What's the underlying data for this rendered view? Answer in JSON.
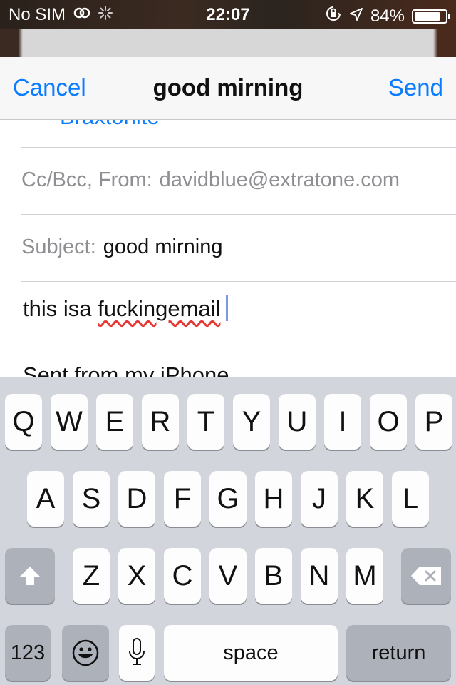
{
  "status_bar": {
    "carrier": "No SIM",
    "time": "22:07",
    "battery_percent": "84%",
    "battery_level": 0.84,
    "icons": [
      "wifi-sync-icon",
      "activity-spinner-icon",
      "orientation-lock-icon",
      "location-arrow-icon",
      "battery-icon"
    ]
  },
  "nav": {
    "cancel_label": "Cancel",
    "title": "good mirning",
    "send_label": "Send"
  },
  "compose": {
    "to_partial": "Braxtonite",
    "cc_label": "Cc/Bcc, From:",
    "from_value": "davidblue@extratone.com",
    "subject_label": "Subject:",
    "subject_value": "good mirning",
    "body_prefix": "this isa ",
    "body_misspelled": "fuckingemail",
    "signature": "Sent from my iPhone"
  },
  "keyboard": {
    "row1": [
      "Q",
      "W",
      "E",
      "R",
      "T",
      "Y",
      "U",
      "I",
      "O",
      "P"
    ],
    "row2": [
      "A",
      "S",
      "D",
      "F",
      "G",
      "H",
      "J",
      "K",
      "L"
    ],
    "row3": [
      "Z",
      "X",
      "C",
      "V",
      "B",
      "N",
      "M"
    ],
    "numbers_label": "123",
    "space_label": "space",
    "return_label": "return"
  },
  "colors": {
    "accent": "#0a7cff",
    "keyboard_bg": "#d2d5db",
    "navbar_bg": "#f7f7f8"
  }
}
